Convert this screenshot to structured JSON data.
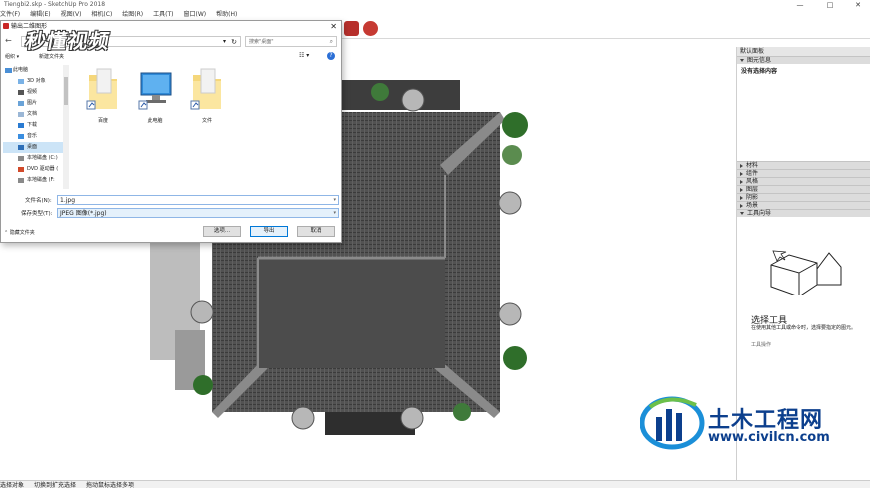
{
  "app": {
    "title": "Tiengbi2.skp - SketchUp Pro 2018",
    "window_controls": [
      "—",
      "□",
      "✕"
    ],
    "menu": [
      "文件(F)",
      "编辑(E)",
      "视图(V)",
      "相机(C)",
      "绘图(R)",
      "工具(T)",
      "窗口(W)",
      "帮助(H)"
    ]
  },
  "tray": {
    "title": "默认面板",
    "entity_info": {
      "header": "图元信息",
      "empty_text": "没有选择内容"
    },
    "sections": [
      "材料",
      "组件",
      "风格",
      "图层",
      "阴影",
      "场景"
    ],
    "instructor": {
      "header": "工具向导",
      "tool_title": "选择工具",
      "description": "在使用其他工具或命令时，选择要指定的图元。",
      "more": "工具操作"
    }
  },
  "dialog": {
    "title": "输出二维图形",
    "close": "✕",
    "back": "←",
    "refresh": "↻",
    "search_placeholder": "搜索\"桌面\"",
    "search_icon": "⌕",
    "organize": "组织 ▾",
    "new_folder": "新建文件夹",
    "view": "☷ ▾",
    "help": "?",
    "nav": [
      {
        "label": "此电脑",
        "level": "top",
        "icon": "computer-icon"
      },
      {
        "label": "3D 对象",
        "level": "child",
        "icon": "3d-objects-icon"
      },
      {
        "label": "视频",
        "level": "child",
        "icon": "video-icon"
      },
      {
        "label": "图片",
        "level": "child",
        "icon": "picture-icon"
      },
      {
        "label": "文档",
        "level": "child",
        "icon": "document-icon"
      },
      {
        "label": "下载",
        "level": "child",
        "icon": "download-icon"
      },
      {
        "label": "音乐",
        "level": "child",
        "icon": "music-icon"
      },
      {
        "label": "桌面",
        "level": "child",
        "icon": "desktop-icon",
        "selected": true
      },
      {
        "label": "本地磁盘 (C:)",
        "level": "child",
        "icon": "disk-icon"
      },
      {
        "label": "DVD 驱动器 (",
        "level": "child",
        "icon": "dvd-icon"
      },
      {
        "label": "本地磁盘 (F:",
        "level": "child",
        "icon": "disk-icon"
      }
    ],
    "files": [
      {
        "label": "百度",
        "icon": "folder-shortcut-icon"
      },
      {
        "label": "此电脑",
        "icon": "computer-shortcut-icon"
      },
      {
        "label": "文件",
        "icon": "folder-shortcut-icon"
      }
    ],
    "file_name_label": "文件名(N):",
    "file_name_value": "1.jpg",
    "save_type_label": "保存类型(T):",
    "save_type_value": "JPEG 图像(*.jpg)",
    "hide_folders": "隐藏文件夹",
    "buttons": {
      "options": "选项...",
      "export": "导出",
      "cancel": "取消"
    }
  },
  "status_bar": [
    "选择对象",
    "切换到扩充选择",
    "拖动鼠标选择多项"
  ],
  "watermarks": {
    "video_site": "秒懂视频",
    "site_name": "土木工程网",
    "site_url": "www.civilcn.com"
  },
  "colors": {
    "selection": "#cce4f7",
    "accent": "#0078d7",
    "roof": "#4a4a4a",
    "tree": "#2f6e2a",
    "watermark_blue": "#0c3f8d"
  }
}
